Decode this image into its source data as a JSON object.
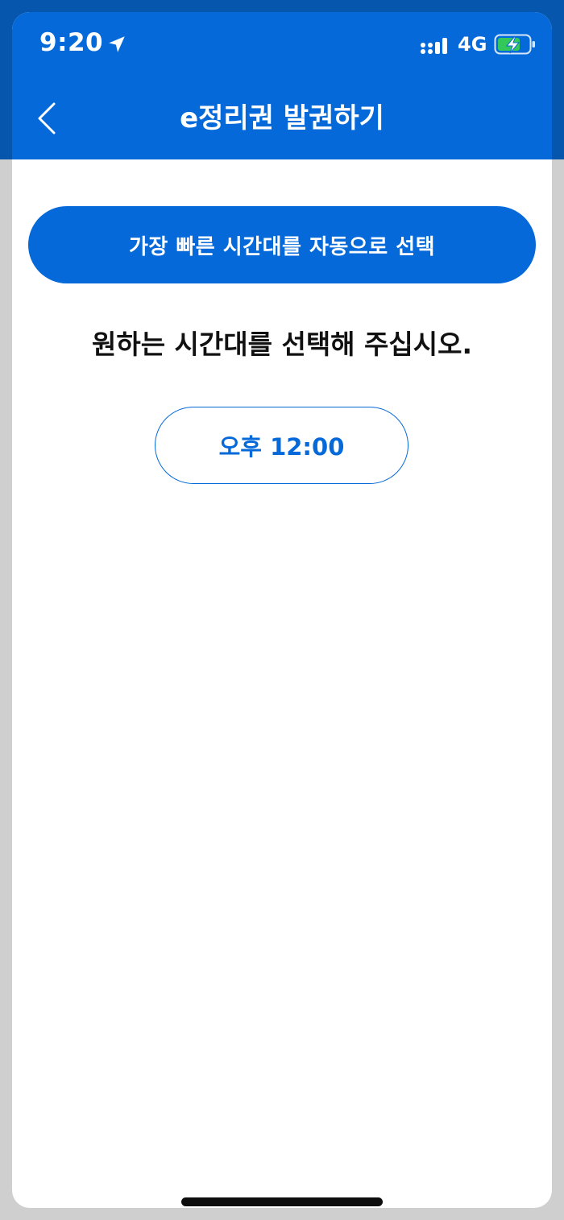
{
  "status_bar": {
    "time": "9:20",
    "network": "4G",
    "location_icon": "location-arrow-icon",
    "signal_icon": "signal-bars-icon",
    "battery_icon": "battery-charging-icon"
  },
  "header": {
    "title": "e정리권 발권하기",
    "back_icon": "chevron-left-icon"
  },
  "main": {
    "auto_select_label": "가장 빠른 시간대를 자동으로 선택",
    "instruction": "원하는 시간대를 선택해 주십시오.",
    "time_slots": [
      {
        "label": "오후 12:00"
      }
    ]
  },
  "colors": {
    "primary": "#0569d9",
    "header_band": "#0656ad",
    "battery_fill": "#34c759",
    "text": "#111111"
  }
}
